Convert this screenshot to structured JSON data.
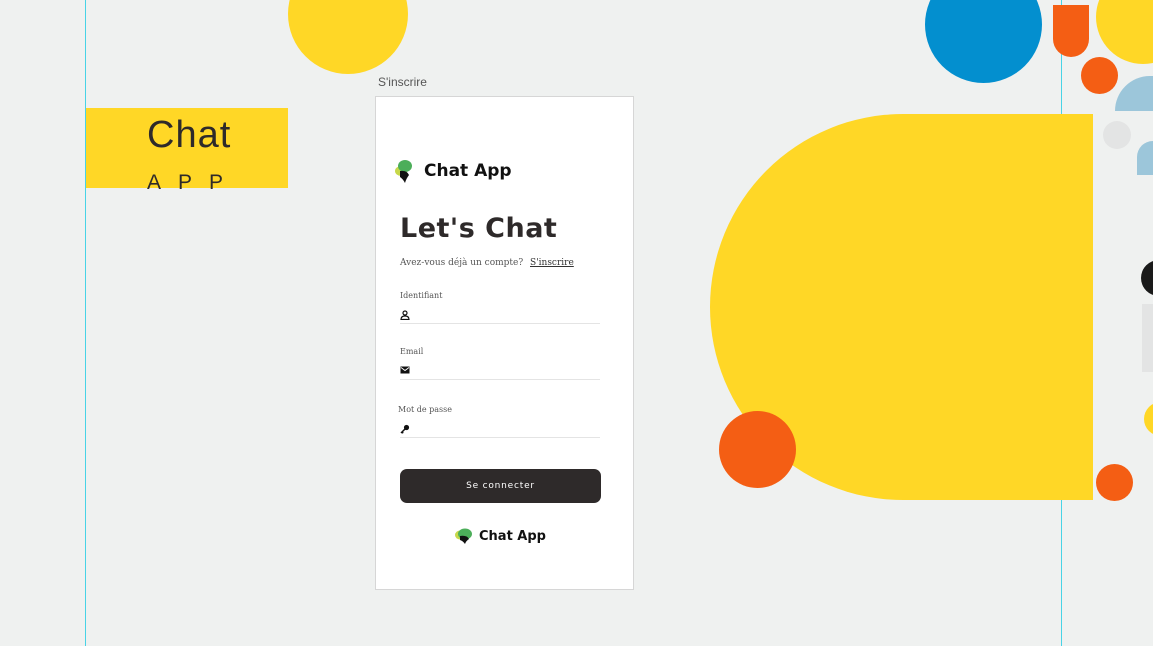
{
  "colors": {
    "background": "#eff1f0",
    "yellow": "#ffd726",
    "orange": "#f45e14",
    "blue": "#038fcf",
    "light_blue": "#9cc6da",
    "dark": "#2e2a2a",
    "guide": "#48d3e6"
  },
  "brand": {
    "title": "Chat",
    "subtitle": "APP"
  },
  "frame": {
    "label": "S'inscrire"
  },
  "login": {
    "app_name": "Chat App",
    "heading": "Let's Chat",
    "prompt": "Avez-vous déjà un compte?",
    "signup_link": "S'inscrire",
    "fields": [
      {
        "label": "Identifiant",
        "icon": "user-icon",
        "value": ""
      },
      {
        "label": "Email",
        "icon": "mail-icon",
        "value": ""
      },
      {
        "label": "Mot de passe",
        "icon": "key-icon",
        "value": ""
      }
    ],
    "submit_label": "Se connecter",
    "footer_app_name": "Chat App"
  }
}
